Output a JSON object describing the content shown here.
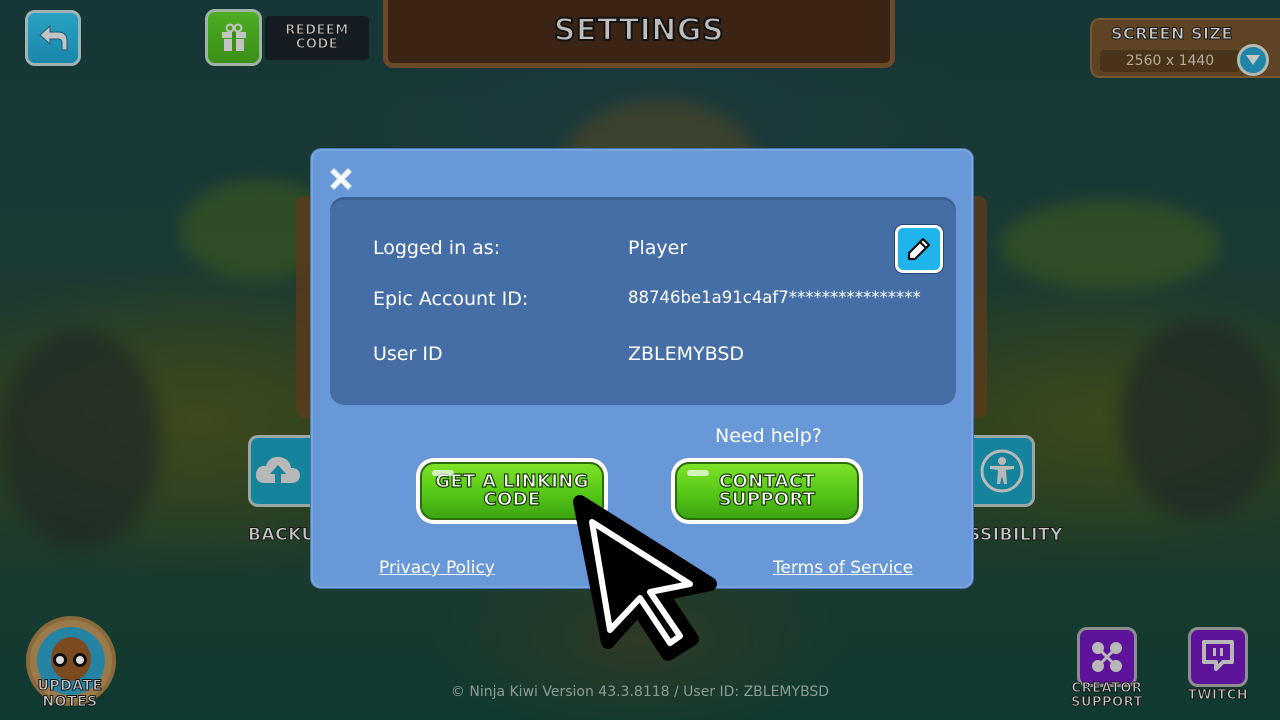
{
  "header": {
    "title": "Settings",
    "redeem_code": [
      "Redeem",
      "Code"
    ],
    "screen_size": {
      "label": "Screen Size",
      "value": "2560 x 1440"
    }
  },
  "side_buttons": {
    "left_label": "BACKU",
    "right_label": "SSIBILITY"
  },
  "dialog": {
    "rows": [
      {
        "label": "Logged in as:",
        "value": "Player"
      },
      {
        "label": "Epic Account ID:",
        "value": "88746be1a91c4af7****************"
      },
      {
        "label": "User ID",
        "value": "ZBLEMYBSD"
      }
    ],
    "need_help": "Need help?",
    "linking_button": [
      "Get a Linking",
      "Code"
    ],
    "support_button": [
      "Contact",
      "Support"
    ],
    "privacy_link": "Privacy Policy",
    "terms_link": "Terms of Service"
  },
  "bottom": {
    "update_notes": "Update Notes",
    "footer": "© Ninja Kiwi Version 43.3.8118 / User ID: ZBLEMYBSD",
    "creator_support": [
      "Creator",
      "Support"
    ],
    "twitch": "Twitch"
  },
  "colors": {
    "dialog_bg": "#6898d8",
    "panel_bg": "#456ea6",
    "green_button": "#55c717",
    "edit_button": "#1fb4ec",
    "purple_button": "#5d139a"
  }
}
